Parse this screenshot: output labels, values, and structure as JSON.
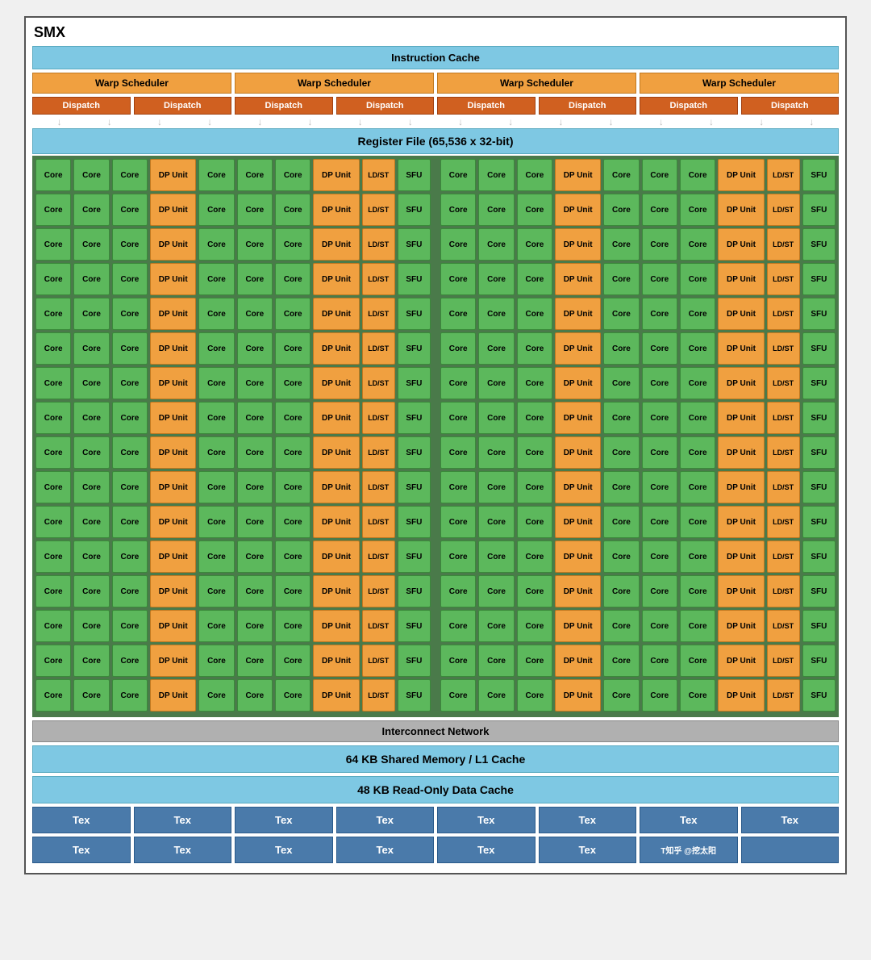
{
  "title": "SMX",
  "instruction_cache": "Instruction Cache",
  "warp_schedulers": [
    "Warp Scheduler",
    "Warp Scheduler",
    "Warp Scheduler",
    "Warp Scheduler"
  ],
  "dispatch_units": [
    "Dispatch",
    "Dispatch",
    "Dispatch",
    "Dispatch",
    "Dispatch",
    "Dispatch",
    "Dispatch",
    "Dispatch"
  ],
  "register_file": "Register File (65,536 x 32-bit)",
  "core_labels": {
    "core": "Core",
    "dp": "DP Unit",
    "ldst": "LD/ST",
    "sfu": "SFU"
  },
  "num_rows": 16,
  "interconnect": "Interconnect Network",
  "shared_memory": "64 KB Shared Memory / L1 Cache",
  "readonly_cache": "48 KB Read-Only Data Cache",
  "tex_units": [
    "Tex",
    "Tex",
    "Tex",
    "Tex",
    "Tex",
    "Tex",
    "Tex",
    "Tex"
  ],
  "tex_units2": [
    "Tex",
    "Tex",
    "Tex",
    "Tex",
    "Tex",
    "Tex",
    "T知乎 @挖太阳",
    ""
  ],
  "colors": {
    "core_bg": "#5cb85c",
    "dp_bg": "#f0a040",
    "ldst_bg": "#f0a040",
    "sfu_bg": "#5cb85c",
    "warp_bg": "#f0a040",
    "dispatch_bg": "#d06020",
    "cache_bg": "#7ec8e3",
    "tex_bg": "#4a7aaa",
    "interconnect_bg": "#b0b0b0",
    "grid_bg": "#4a7a4a"
  }
}
